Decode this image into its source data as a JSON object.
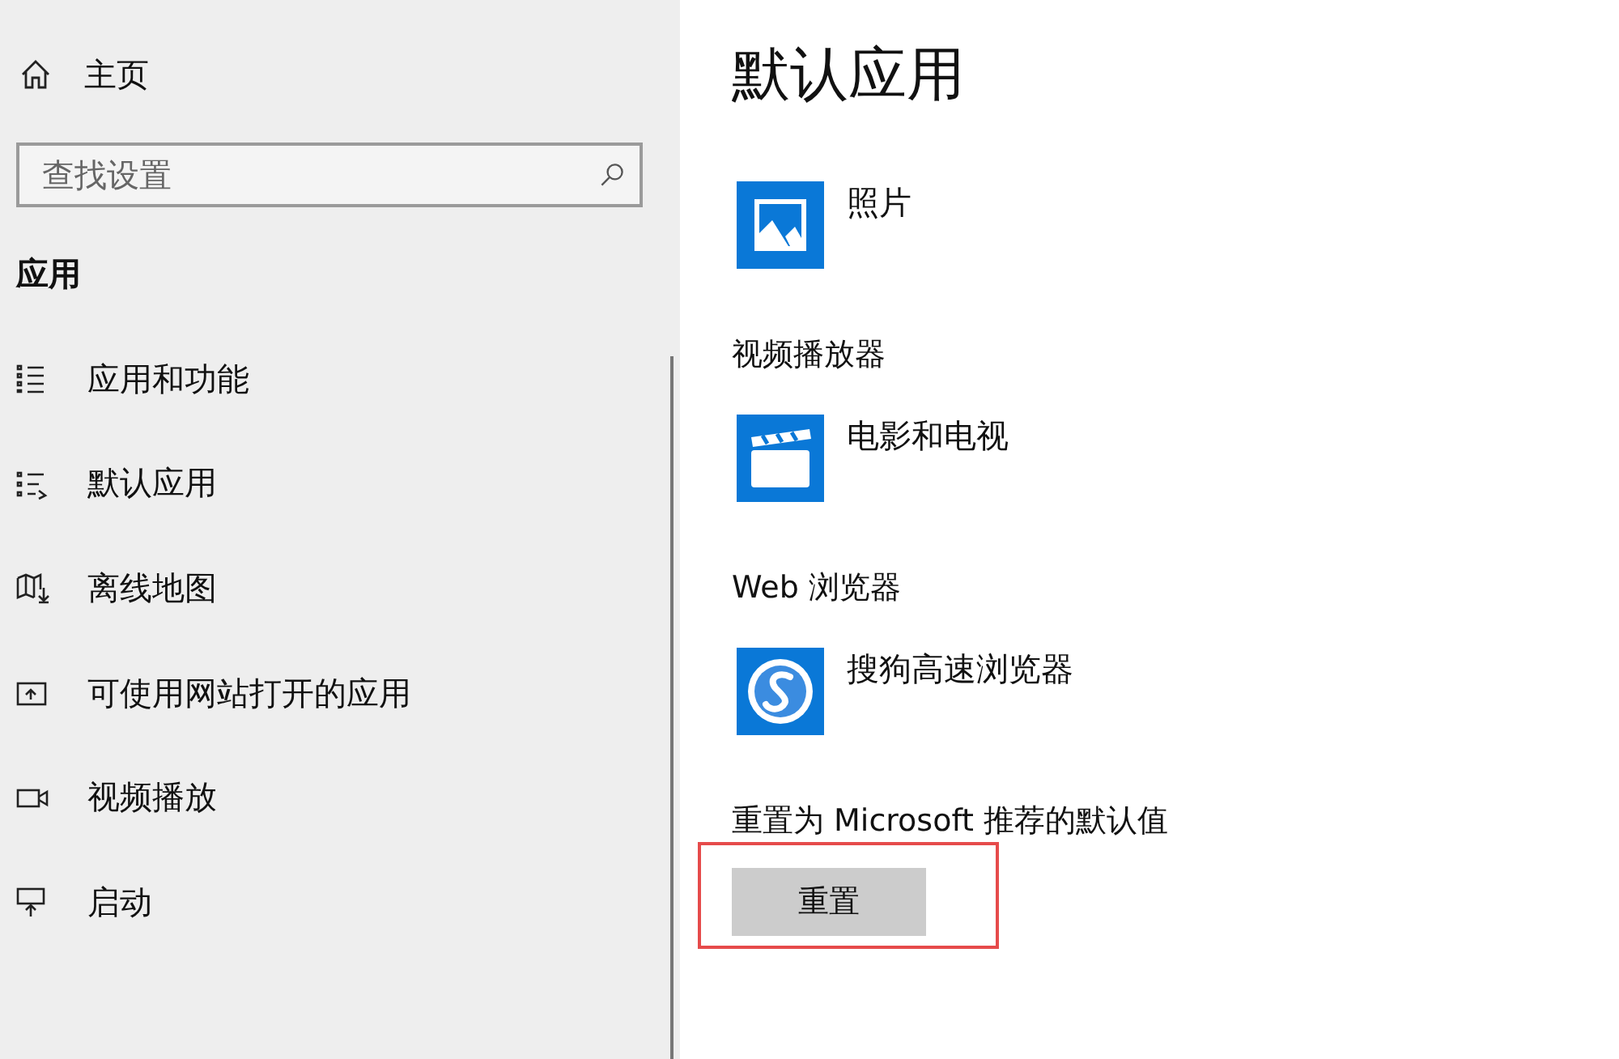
{
  "sidebar": {
    "home": {
      "label": "主页"
    },
    "search": {
      "placeholder": "查找设置"
    },
    "heading": "应用",
    "items": [
      {
        "label": "应用和功能"
      },
      {
        "label": "默认应用"
      },
      {
        "label": "离线地图"
      },
      {
        "label": "可使用网站打开的应用"
      },
      {
        "label": "视频播放"
      },
      {
        "label": "启动"
      }
    ]
  },
  "main": {
    "title": "默认应用",
    "sections": [
      {
        "app": "照片"
      },
      {
        "heading": "视频播放器",
        "app": "电影和电视"
      },
      {
        "heading": "Web 浏览器",
        "app": "搜狗高速浏览器"
      }
    ],
    "reset": {
      "label": "重置为 Microsoft 推荐的默认值",
      "button": "重置",
      "highlighted": true
    }
  }
}
